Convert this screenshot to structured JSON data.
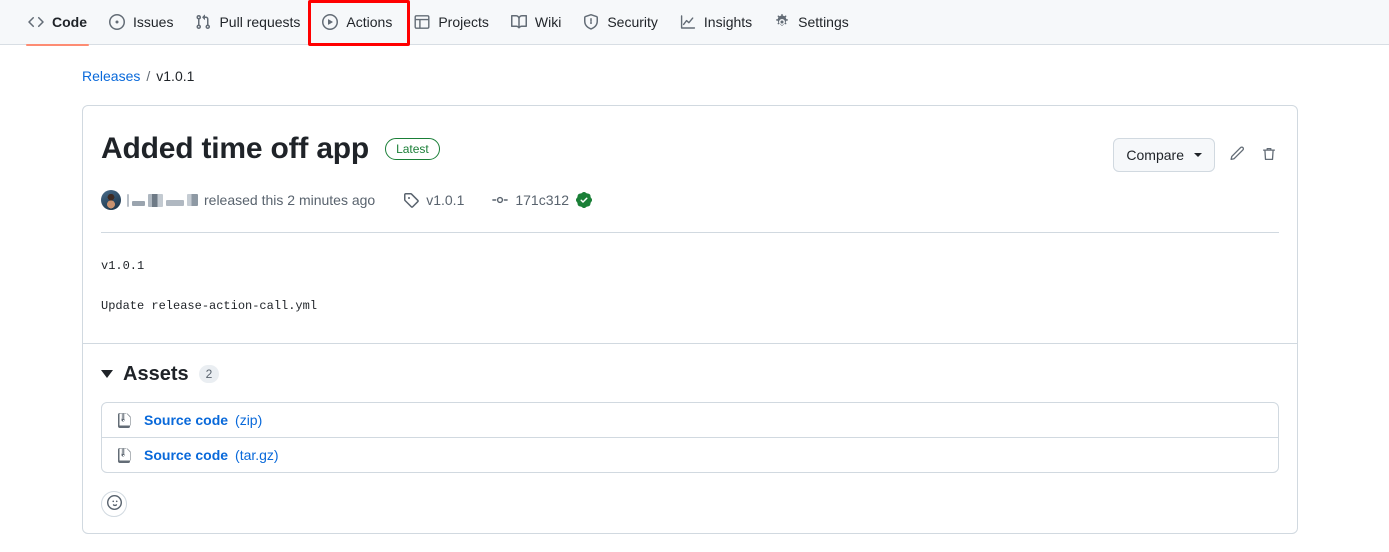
{
  "colors": {
    "accent_link": "#0969da",
    "active_tab_underline": "#fd8c73",
    "latest_green": "#1a7f37",
    "annotation_red": "#ff0000",
    "header_bg": "#f6f8fa",
    "border": "#d1d9e0"
  },
  "repo_nav": {
    "items": [
      {
        "label": "Code",
        "icon": "code-icon",
        "active": true
      },
      {
        "label": "Issues",
        "icon": "issue-opened-icon",
        "active": false
      },
      {
        "label": "Pull requests",
        "icon": "git-pull-request-icon",
        "active": false
      },
      {
        "label": "Actions",
        "icon": "play-icon",
        "active": false
      },
      {
        "label": "Projects",
        "icon": "table-icon",
        "active": false
      },
      {
        "label": "Wiki",
        "icon": "book-icon",
        "active": false
      },
      {
        "label": "Security",
        "icon": "shield-icon",
        "active": false
      },
      {
        "label": "Insights",
        "icon": "graph-icon",
        "active": false
      },
      {
        "label": "Settings",
        "icon": "gear-icon",
        "active": false
      }
    ],
    "highlighted_item": "Actions"
  },
  "breadcrumb": {
    "root_label": "Releases",
    "separator": "/",
    "current_label": "v1.0.1"
  },
  "release": {
    "title": "Added time off app",
    "latest_badge": "Latest",
    "compare_button": "Compare",
    "edit_icon": "pencil-icon",
    "delete_icon": "trash-icon",
    "meta": {
      "author_name_redacted": true,
      "released_text": "released this 2 minutes ago",
      "tag_icon": "tag-icon",
      "tag_name": "v1.0.1",
      "commit_icon": "git-commit-icon",
      "commit_sha": "171c312",
      "verified_icon": "verified-check-icon"
    },
    "body_lines": [
      "v1.0.1",
      "Update release-action-call.yml"
    ]
  },
  "assets": {
    "title": "Assets",
    "count": "2",
    "expanded": true,
    "items": [
      {
        "icon": "file-zip-icon",
        "name": "Source code",
        "ext": "(zip)"
      },
      {
        "icon": "file-zip-icon",
        "name": "Source code",
        "ext": "(tar.gz)"
      }
    ]
  },
  "reactions": {
    "add_reaction_icon": "smiley-icon"
  }
}
